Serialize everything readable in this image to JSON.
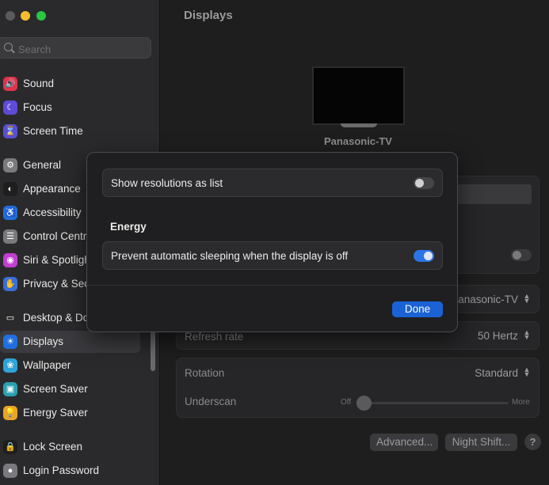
{
  "window": {
    "traffic_lights": {
      "close": "#5b5b5e",
      "minimize": "#fbbd2e",
      "maximize": "#28c840"
    }
  },
  "sidebar": {
    "search_placeholder": "Search",
    "items": [
      {
        "label": "Sound",
        "icon": "sound-icon",
        "color": "#e0344a",
        "glyph": "🔊"
      },
      {
        "label": "Focus",
        "icon": "moon-icon",
        "color": "#5e4bd6",
        "glyph": "☾"
      },
      {
        "label": "Screen Time",
        "icon": "hourglass-icon",
        "color": "#5a4fd1",
        "glyph": "⌛"
      },
      {
        "label": "General",
        "icon": "gear-icon",
        "color": "#7a7a7e",
        "glyph": "⚙"
      },
      {
        "label": "Appearance",
        "icon": "appearance-icon",
        "color": "#1e1e1e",
        "glyph": "◐"
      },
      {
        "label": "Accessibility",
        "icon": "accessibility-icon",
        "color": "#1f6fe0",
        "glyph": "♿"
      },
      {
        "label": "Control Centre",
        "icon": "control-centre-icon",
        "color": "#7a7a7e",
        "glyph": "☰"
      },
      {
        "label": "Siri & Spotlight",
        "icon": "siri-icon",
        "color": "#c03fd0",
        "glyph": "◉"
      },
      {
        "label": "Privacy & Security",
        "icon": "hand-icon",
        "color": "#3a6fd8",
        "glyph": "✋"
      },
      {
        "label": "Desktop & Dock",
        "icon": "dock-icon",
        "color": "#2a2a2a",
        "glyph": "▭"
      },
      {
        "label": "Displays",
        "icon": "sun-icon",
        "color": "#1f6fe0",
        "glyph": "☀"
      },
      {
        "label": "Wallpaper",
        "icon": "wallpaper-icon",
        "color": "#2fa4d8",
        "glyph": "❀"
      },
      {
        "label": "Screen Saver",
        "icon": "screen-saver-icon",
        "color": "#2aa0b0",
        "glyph": "▣"
      },
      {
        "label": "Energy Saver",
        "icon": "bulb-icon",
        "color": "#e8a42a",
        "glyph": "💡"
      },
      {
        "label": "Lock Screen",
        "icon": "lock-icon",
        "color": "#1e1e1e",
        "glyph": "🔒"
      },
      {
        "label": "Login Password",
        "icon": "login-icon",
        "color": "#7a7a7e",
        "glyph": "●"
      }
    ]
  },
  "main": {
    "title": "Displays",
    "display_name": "Panasonic-TV",
    "use_as_value": "Panasonic-TV",
    "refresh_rate_label": "Refresh rate",
    "refresh_rate_value": "50 Hertz",
    "rotation_label": "Rotation",
    "rotation_value": "Standard",
    "underscan_label": "Underscan",
    "underscan_min": "Off",
    "underscan_max": "More",
    "advanced_button": "Advanced...",
    "night_shift_button": "Night Shift...",
    "help_button": "?"
  },
  "dialog": {
    "show_resolutions_label": "Show resolutions as list",
    "show_resolutions_on": false,
    "energy_heading": "Energy",
    "prevent_sleep_label": "Prevent automatic sleeping when the display is off",
    "prevent_sleep_on": true,
    "done_button": "Done"
  },
  "colors": {
    "accent": "#2c74e6",
    "done_button": "#1a62d6"
  }
}
